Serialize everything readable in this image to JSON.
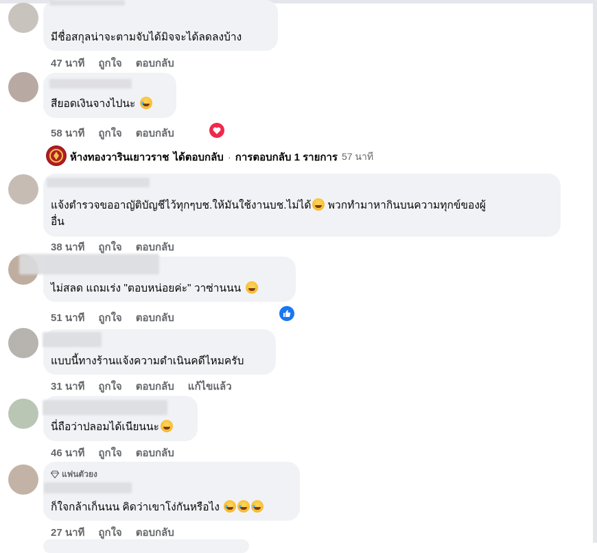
{
  "colors": {
    "bubble": "#f0f2f5",
    "meta": "#65676b",
    "love": "#f0284a",
    "like": "#1877f2"
  },
  "labels": {
    "like": "ถูกใจ",
    "reply": "ตอบกลับ",
    "edited": "แก้ไขแล้ว"
  },
  "comments": [
    {
      "text": "มีชื่อสกุลน่าจะตามจับได้มิจจะได้ลดลงบ้าง",
      "time": "47 นาที"
    },
    {
      "text": "สียอดเงินจางไปนะ",
      "emoji": "rofl-emoji",
      "time": "58 นาที",
      "reaction": "heart-reaction-icon"
    },
    {
      "text": "แจ้งตำรวจขออาญัติบัญชีไว้ทุกๆบช.ให้มันใช้งานบช.ไม่ได้",
      "emoji": "flushed-emoji",
      "text2": "พวกทำมาหากินบนความทุกข์ของผู้",
      "text3": "อื่น",
      "time": "38 นาที"
    },
    {
      "text": "ไม่สลด แถมเร่ง \"ตอบหน่อยค่ะ\" วาซ่านนน",
      "emoji": "grin-sweat-emoji",
      "time": "51 นาที",
      "reaction": "like-reaction-icon"
    },
    {
      "text": "แบบนี้ทางร้านแจ้งความดำเนินคดีไหมครับ",
      "time": "31 นาที",
      "edited": true
    },
    {
      "text": "นี่ถือว่าปลอมได้เนียนนะ",
      "emoji": "grin-sweat-emoji",
      "time": "46 นาที"
    },
    {
      "badge": "แฟนตัวยง",
      "text": "ก็ใจกล้าเก็นนน คิดว่าเขาโง่กันหรือไง",
      "emoji": "rofl-emoji",
      "time": "27 นาที"
    }
  ],
  "reply_summary": {
    "page_name": "ห้างทองวารินเยาวราช",
    "action": "ได้ตอบกลับ",
    "separator": "·",
    "count": "การตอบกลับ 1 รายการ",
    "time": "57 นาที"
  }
}
